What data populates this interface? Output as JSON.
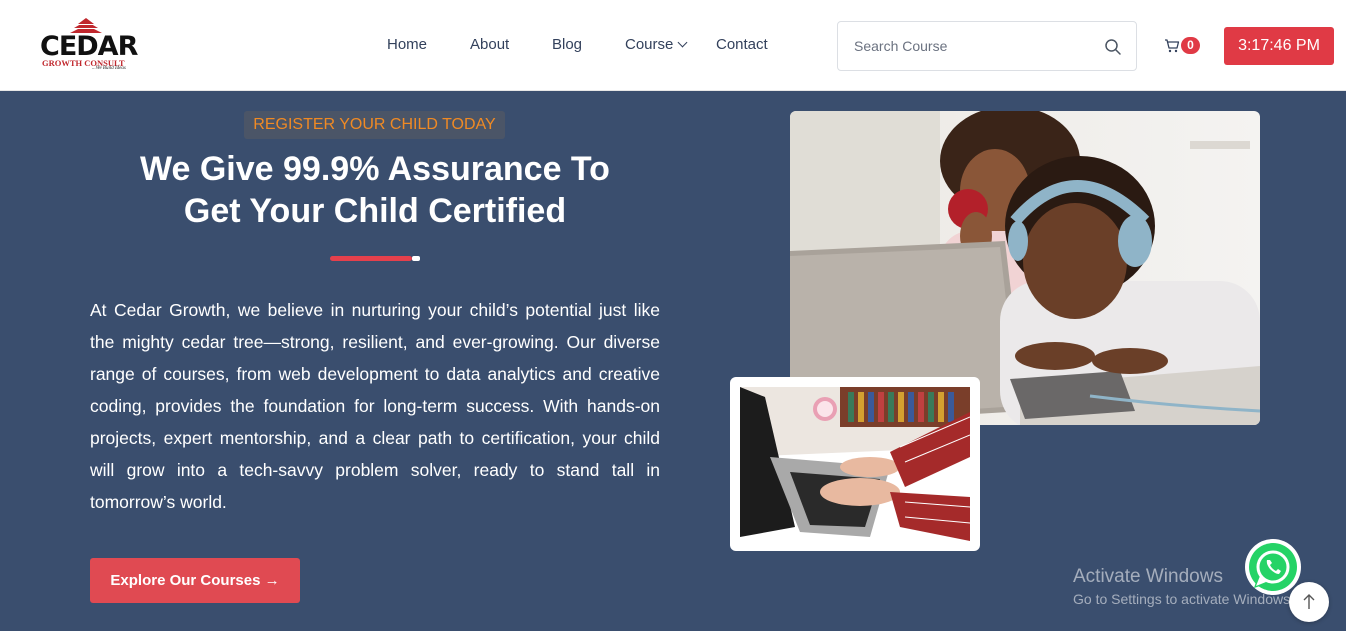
{
  "header": {
    "logo": {
      "name": "CEDAR",
      "subtitle": "GROWTH CONSULT",
      "tagline": "...We Build Ideas"
    },
    "nav": [
      {
        "label": "Home"
      },
      {
        "label": "About"
      },
      {
        "label": "Blog"
      },
      {
        "label": "Course",
        "has_dropdown": true
      },
      {
        "label": "Contact"
      }
    ],
    "search": {
      "placeholder": "Search Course",
      "icon": "search-icon"
    },
    "cart": {
      "count": "0",
      "icon": "cart-icon"
    },
    "clock": "3:17:46 PM"
  },
  "hero": {
    "eyebrow": "REGISTER YOUR CHILD TODAY",
    "title_line1": "We Give 99.9% Assurance To",
    "title_line2": "Get Your Child Certified",
    "description": "At Cedar Growth, we believe in nurturing your child’s potential just like the mighty cedar tree—strong, resilient, and ever-growing. Our diverse range of courses, from web development to data analytics and creative coding, provides the foundation for long-term success. With hands-on projects, expert mentorship, and a clear path to certification, your child will grow into a tech-savvy problem solver, ready to stand tall in tomorrow’s world.",
    "cta_label": "Explore Our Courses",
    "cta_icon": "arrow-right-icon"
  },
  "watermark": {
    "line1": "Activate Windows",
    "line2": "Go to Settings to activate Windows."
  },
  "colors": {
    "hero_bg": "#3a4e6e",
    "accent_red": "#e03a45",
    "eyebrow_orange": "#f08a24",
    "whatsapp_green": "#25d366"
  }
}
